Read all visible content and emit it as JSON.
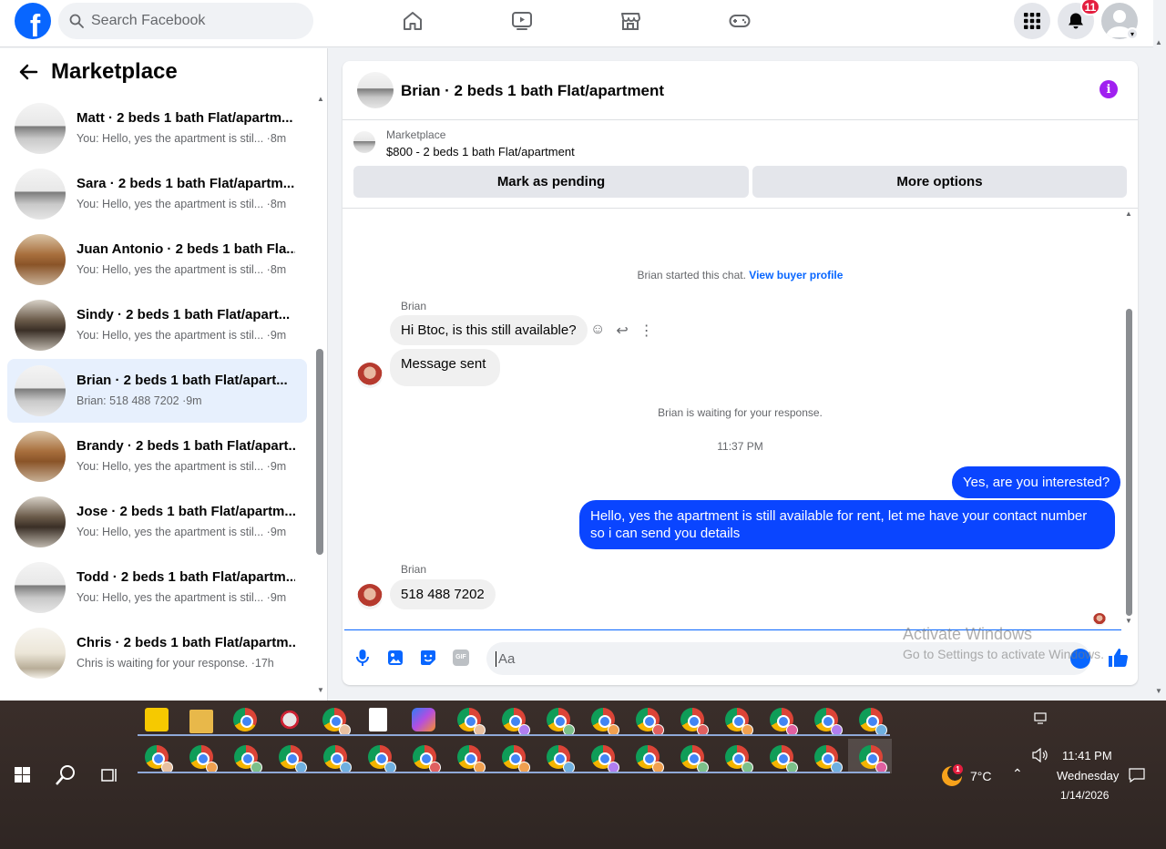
{
  "topbar": {
    "logo": "f",
    "search_placeholder": "Search Facebook",
    "notification_count": "11",
    "icons": [
      "home-icon",
      "video-icon",
      "marketplace-icon",
      "gaming-icon",
      "menu-grid-icon",
      "bell-icon",
      "profile-avatar"
    ]
  },
  "left": {
    "title": "Marketplace",
    "conversations": [
      {
        "name": "Matt · 2 beds 1 bath Flat/apartm...",
        "preview": "You: Hello, yes the apartment is stil... ·8m",
        "thumb": "white"
      },
      {
        "name": "Sara · 2 beds 1 bath Flat/apartm...",
        "preview": "You: Hello, yes the apartment is stil... ·8m",
        "thumb": "white"
      },
      {
        "name": "Juan Antonio · 2 beds 1 bath Fla...",
        "preview": "You: Hello, yes the apartment is stil... ·8m",
        "thumb": "wood"
      },
      {
        "name": "Sindy · 2 beds 1 bath Flat/apart...",
        "preview": "You: Hello, yes the apartment is stil... ·9m",
        "thumb": "dark"
      },
      {
        "name": "Brian · 2 beds 1 bath Flat/apart...",
        "preview": "Brian: 518 488 7202 ·9m",
        "thumb": "white"
      },
      {
        "name": "Brandy · 2 beds 1 bath Flat/apart...",
        "preview": "You: Hello, yes the apartment is stil... ·9m",
        "thumb": "wood"
      },
      {
        "name": "Jose · 2 beds 1 bath Flat/apartm...",
        "preview": "You: Hello, yes the apartment is stil... ·9m",
        "thumb": "dark"
      },
      {
        "name": "Todd · 2 beds 1 bath Flat/apartm...",
        "preview": "You: Hello, yes the apartment is stil... ·9m",
        "thumb": "white"
      },
      {
        "name": "Chris · 2 beds 1 bath Flat/apartm...",
        "preview": "Chris is waiting for your response. ·17h",
        "thumb": "bright"
      }
    ],
    "selected_index": 4
  },
  "chat": {
    "title": "Brian · 2 beds 1 bath Flat/apartment",
    "marketplace_label": "Marketplace",
    "listing": "$800 - 2 beds 1 bath Flat/apartment",
    "mark_pending": "Mark as pending",
    "more_options": "More options",
    "started_text": "Brian started this chat.",
    "buyer_profile_link": "View buyer profile",
    "sender_name": "Brian",
    "msg1": "Hi Btoc, is this still available?",
    "msg2": "Message sent",
    "waiting": "Brian is waiting for your response.",
    "timestamp": "11:37 PM",
    "out1": "Yes, are you interested?",
    "out2": "Hello, yes the apartment is still available for rent, let me have your contact number so i can send you details",
    "sender_name2": "Brian",
    "msg3": "518 488 7202",
    "compose_placeholder": "Aa",
    "gif": "GIF"
  },
  "watermark": {
    "line1": "Activate Windows",
    "line2": "Go to Settings to activate Windows."
  },
  "taskbar": {
    "weather": "7°C",
    "weather_badge": "1",
    "time": "11:41 PM",
    "day": "Wednesday",
    "date": "1/14/2026"
  }
}
